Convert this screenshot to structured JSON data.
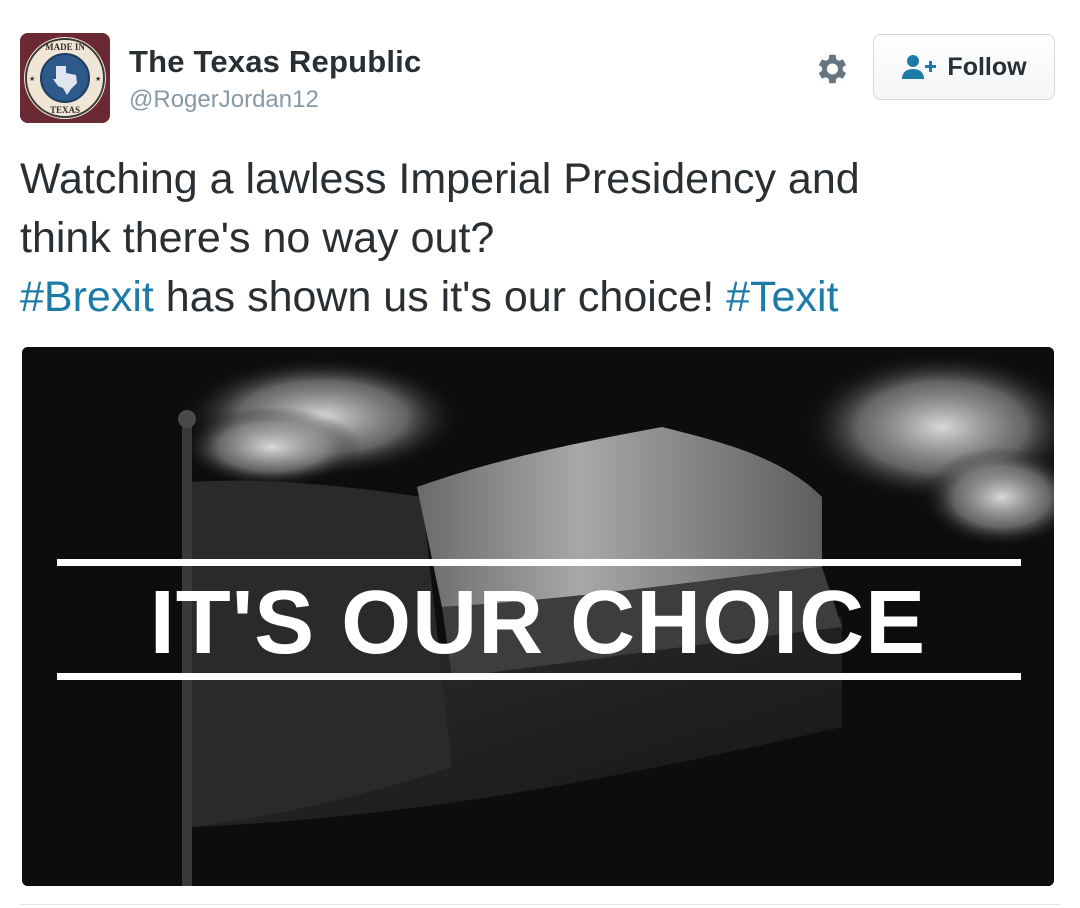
{
  "account": {
    "display_name": "The Texas Republic",
    "handle": "@RogerJordan12",
    "avatar_text_top": "MADE IN",
    "avatar_text_bottom": "TEXAS"
  },
  "actions": {
    "settings_icon": "gear-icon",
    "follow_icon": "add-user-icon",
    "follow_label": "Follow"
  },
  "tweet": {
    "line1": "Watching a lawless Imperial Presidency and",
    "line2": "think there's no way out?",
    "hashtag1": "#Brexit",
    "line3_middle": " has shown us it's our choice! ",
    "hashtag2": "#Texit"
  },
  "media": {
    "caption": "IT'S OUR CHOICE"
  },
  "colors": {
    "hashtag": "#1d7ba8",
    "text": "#292f33",
    "handle": "#8899a6"
  }
}
